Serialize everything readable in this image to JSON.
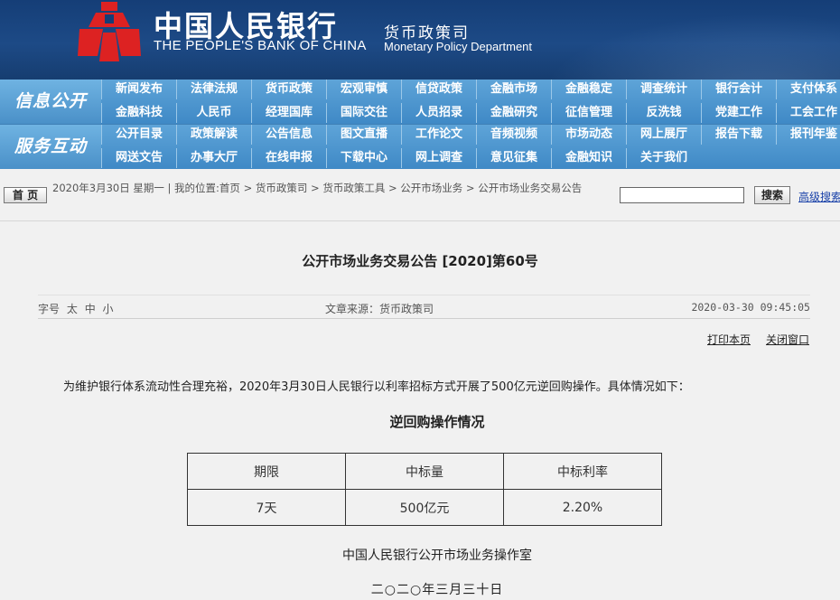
{
  "header": {
    "bank_name_cn": "中国人民银行",
    "bank_name_en": "THE PEOPLE'S BANK OF CHINA",
    "dept_cn": "货币政策司",
    "dept_en": "Monetary Policy Department"
  },
  "nav": {
    "info_label": "信息公开",
    "info_row1": [
      "新闻发布",
      "法律法规",
      "货币政策",
      "宏观审慎",
      "信贷政策",
      "金融市场",
      "金融稳定",
      "调查统计",
      "银行会计",
      "支付体系"
    ],
    "info_row2": [
      "金融科技",
      "人民币",
      "经理国库",
      "国际交往",
      "人员招录",
      "金融研究",
      "征信管理",
      "反洗钱",
      "党建工作",
      "工会工作"
    ],
    "service_label": "服务互动",
    "service_row1": [
      "公开目录",
      "政策解读",
      "公告信息",
      "图文直播",
      "工作论文",
      "音频视频",
      "市场动态",
      "网上展厅",
      "报告下载",
      "报刊年鉴"
    ],
    "service_row2": [
      "网送文告",
      "办事大厅",
      "在线申报",
      "下载中心",
      "网上调查",
      "意见征集",
      "金融知识",
      "关于我们"
    ]
  },
  "crumbs": {
    "home_label": "首 页",
    "text": "2020年3月30日  星期一  | 我的位置:首页  >  货币政策司  >  货币政策工具  >  公开市场业务  >  公开市场业务交易公告",
    "search_button": "搜索",
    "advanced_search": "高级搜索"
  },
  "article": {
    "title": "公开市场业务交易公告 [2020]第60号",
    "font_label": "字号",
    "font_sizes": [
      "太",
      "中",
      "小"
    ],
    "source": "文章来源：货币政策司",
    "datetime": "2020-03-30  09:45:05",
    "print": "打印本页",
    "close": "关闭窗口",
    "paragraph": "为维护银行体系流动性合理充裕，2020年3月30日人民银行以利率招标方式开展了500亿元逆回购操作。具体情况如下：",
    "table_title": "逆回购操作情况",
    "table_headers": [
      "期限",
      "中标量",
      "中标利率"
    ],
    "table_row": [
      "7天",
      "500亿元",
      "2.20%"
    ],
    "signature": "中国人民银行公开市场业务操作室",
    "date_cn": "二○二○年三月三十日"
  }
}
